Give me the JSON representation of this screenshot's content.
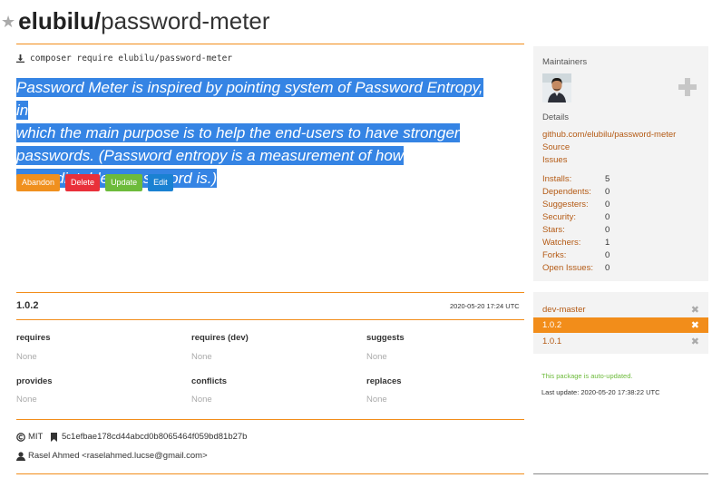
{
  "package": {
    "vendor": "elubilu/",
    "name": "password-meter",
    "install_cmd": "composer require elubilu/password-meter",
    "description": "Password Meter is inspired by pointing system of Password Entropy, in which the main purpose is to help the end-users to have stronger passwords. (Password entropy is a measurement of how unpredictable a password is.)",
    "description_lines": [
      "Password Meter is inspired by pointing system of Password Entropy, in",
      "which the main purpose is to help the end-users to have stronger",
      "passwords. (Password entropy is a measurement of how",
      "unpredictable a password is.)"
    ]
  },
  "actions": {
    "abandon": "Abandon",
    "delete": "Delete",
    "update": "Update",
    "edit": "Edit"
  },
  "sidebar": {
    "maintainers_label": "Maintainers",
    "details_label": "Details",
    "repo_link": "github.com/elubilu/password-meter",
    "source_link": "Source",
    "issues_link": "Issues",
    "stats": [
      {
        "label": "Installs:",
        "value": "5"
      },
      {
        "label": "Dependents:",
        "value": "0"
      },
      {
        "label": "Suggesters:",
        "value": "0"
      },
      {
        "label": "Security:",
        "value": "0"
      },
      {
        "label": "Stars:",
        "value": "0"
      },
      {
        "label": "Watchers:",
        "value": "1"
      },
      {
        "label": "Forks:",
        "value": "0"
      },
      {
        "label": "Open Issues:",
        "value": "0"
      }
    ]
  },
  "versions": [
    {
      "name": "dev-master",
      "active": false
    },
    {
      "name": "1.0.2",
      "active": true
    },
    {
      "name": "1.0.1",
      "active": false
    }
  ],
  "update_info": {
    "auto_updated": "This package is auto-updated.",
    "last_update": "Last update: 2020-05-20 17:38:22 UTC"
  },
  "version_detail": {
    "number": "1.0.2",
    "date": "2020-05-20 17:24 UTC",
    "deps": [
      {
        "title": "requires",
        "value": "None"
      },
      {
        "title": "requires (dev)",
        "value": "None"
      },
      {
        "title": "suggests",
        "value": "None"
      },
      {
        "title": "provides",
        "value": "None"
      },
      {
        "title": "conflicts",
        "value": "None"
      },
      {
        "title": "replaces",
        "value": "None"
      }
    ],
    "license": "MIT",
    "commit_hash": "5c1efbae178cd44abcd0b8065464f059bd81b27b",
    "author": "Rasel Ahmed <raselahmed.lucse@gmail.com>"
  },
  "colors": {
    "accent": "#f28d1a",
    "link": "#b45a14",
    "selection": "#3584e4",
    "abandon": "#f0901e",
    "delete": "#e9303a",
    "update": "#6dbb3b",
    "edit": "#1a81d2"
  },
  "icons": {
    "favorite": "star-icon",
    "install": "download-icon",
    "add_maintainer": "plus-icon",
    "remove_version": "close-icon",
    "license": "copyright-icon",
    "commit": "bookmark-icon",
    "author": "user-icon"
  }
}
